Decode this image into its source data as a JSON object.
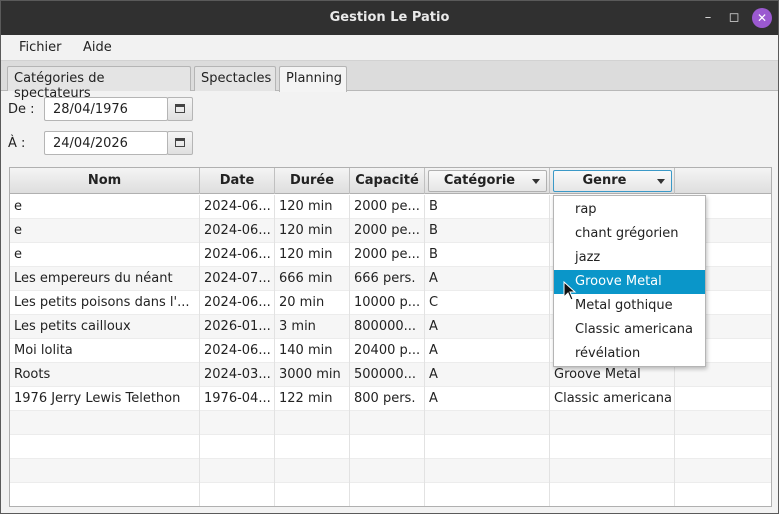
{
  "window": {
    "title": "Gestion Le Patio"
  },
  "menubar": {
    "items": [
      "Fichier",
      "Aide"
    ]
  },
  "tabs": [
    {
      "label": "Catégories de spectateurs"
    },
    {
      "label": "Spectacles"
    },
    {
      "label": "Planning"
    }
  ],
  "active_tab": "Planning",
  "filters": {
    "from_label": "De :",
    "from_value": "28/04/1976",
    "to_label": "À :",
    "to_value": "24/04/2026"
  },
  "table": {
    "columns": [
      "Nom",
      "Date",
      "Durée",
      "Capacité",
      "Catégorie",
      "Genre"
    ],
    "rows": [
      [
        "e",
        "2024-06...",
        "120 min",
        "2000 pe...",
        "B",
        ""
      ],
      [
        "e",
        "2024-06...",
        "120 min",
        "2000 pe...",
        "B",
        ""
      ],
      [
        "e",
        "2024-06...",
        "120 min",
        "2000 pe...",
        "B",
        ""
      ],
      [
        "Les empereurs du néant",
        "2024-07...",
        "666 min",
        "666 pers.",
        "A",
        ""
      ],
      [
        "Les petits poisons dans l'...",
        "2024-06...",
        "20 min",
        "10000 p...",
        "C",
        ""
      ],
      [
        "Les petits cailloux",
        "2026-01...",
        "3 min",
        "800000...",
        "A",
        ""
      ],
      [
        "Moi lolita",
        "2024-06...",
        "140 min",
        "20400 p...",
        "A",
        ""
      ],
      [
        "Roots",
        "2024-03...",
        "3000 min",
        "500000...",
        "A",
        "Groove Metal"
      ],
      [
        "1976 Jerry Lewis Telethon",
        "1976-04...",
        "122 min",
        "800 pers.",
        "A",
        "Classic americana"
      ]
    ],
    "empty_rows": 5
  },
  "genre_dropdown": {
    "options": [
      "rap",
      "chant grégorien",
      "jazz",
      "Groove Metal",
      "Metal gothique",
      "Classic americana",
      "révélation"
    ],
    "highlighted": "Groove Metal"
  },
  "colors": {
    "accent": "#0a96c9",
    "titlebar": "#303030",
    "close_button": "#9b59d0",
    "focus_border": "#3b99c7"
  }
}
